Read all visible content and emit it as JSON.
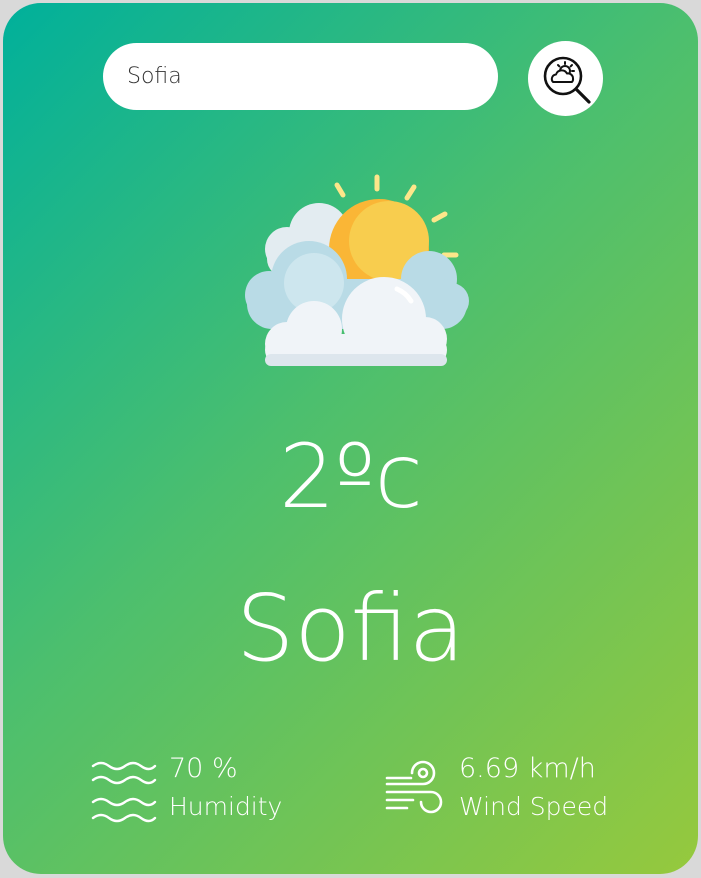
{
  "search": {
    "value": "Sofia",
    "button_icon": "weather-search-icon"
  },
  "weather": {
    "icon": "partly-cloudy-sun-icon",
    "temperature": "2ºc",
    "city": "Sofia"
  },
  "details": {
    "humidity": {
      "icon": "humidity-waves-icon",
      "value": "70 %",
      "label": "Humidity"
    },
    "wind": {
      "icon": "wind-icon",
      "value": "6.69 km/h",
      "label": "Wind Speed"
    }
  },
  "colors": {
    "gradient_start": "#00b09b",
    "gradient_end": "#96c93d",
    "text": "#ffffff"
  }
}
